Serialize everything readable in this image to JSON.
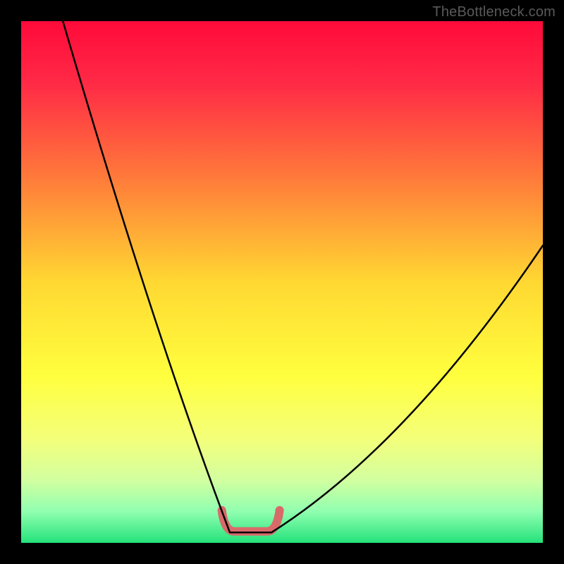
{
  "watermark": "TheBottleneck.com",
  "chart_data": {
    "type": "line",
    "title": "",
    "xlabel": "",
    "ylabel": "",
    "xlim": [
      0,
      100
    ],
    "ylim": [
      0,
      100
    ],
    "grid": false,
    "legend": false,
    "series": [
      {
        "name": "bottleneck-curve",
        "x_left_top": 8,
        "y_left_top": 100,
        "trough_x_start": 40,
        "trough_x_end": 48,
        "trough_y": 2,
        "x_right_end": 100,
        "y_right_end": 57,
        "color": "#000000"
      }
    ],
    "highlight": {
      "name": "trough-marker",
      "x_start": 39,
      "x_end": 49,
      "y": 3,
      "color": "#d86a6a",
      "thickness": 12
    },
    "gradient_stops": [
      {
        "offset": 0.0,
        "color": "#ff0a3a"
      },
      {
        "offset": 0.12,
        "color": "#ff2a46"
      },
      {
        "offset": 0.3,
        "color": "#ff7a3a"
      },
      {
        "offset": 0.5,
        "color": "#ffd832"
      },
      {
        "offset": 0.68,
        "color": "#ffff3e"
      },
      {
        "offset": 0.8,
        "color": "#f4ff7a"
      },
      {
        "offset": 0.88,
        "color": "#d2ffa0"
      },
      {
        "offset": 0.94,
        "color": "#90ffb0"
      },
      {
        "offset": 1.0,
        "color": "#24e27a"
      }
    ]
  }
}
